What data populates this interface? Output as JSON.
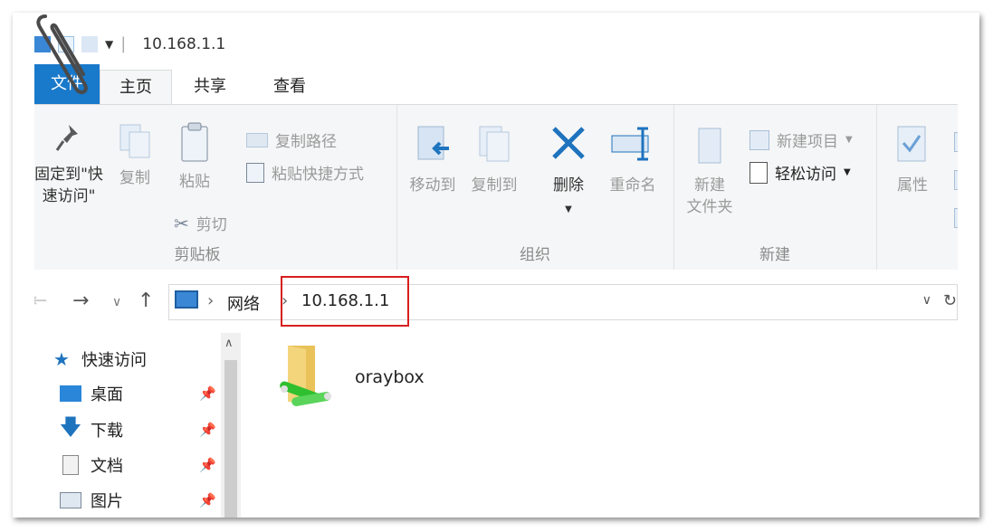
{
  "window": {
    "title": "10.168.1.1"
  },
  "tabs": {
    "file": "文件",
    "home": "主页",
    "share": "共享",
    "view": "查看"
  },
  "ribbon": {
    "clipboard": {
      "pin_line1": "固定到\"快",
      "pin_line2": "速访问\"",
      "copy": "复制",
      "paste": "粘贴",
      "copy_path": "复制路径",
      "paste_shortcut": "粘贴快捷方式",
      "cut": "剪切",
      "label": "剪贴板"
    },
    "organize": {
      "move_to": "移动到",
      "copy_to": "复制到",
      "delete": "删除",
      "rename": "重命名",
      "label": "组织"
    },
    "new": {
      "new_folder_line1": "新建",
      "new_folder_line2": "文件夹",
      "new_item": "新建项目",
      "easy_access": "轻松访问",
      "label": "新建"
    },
    "open": {
      "properties": "属性"
    }
  },
  "address": {
    "segments": [
      "网络",
      "10.168.1.1"
    ]
  },
  "nav": {
    "items": [
      {
        "label": "快速访问"
      },
      {
        "label": "桌面"
      },
      {
        "label": "下载"
      },
      {
        "label": "文档"
      },
      {
        "label": "图片"
      }
    ]
  },
  "content": {
    "items": [
      {
        "name": "oraybox"
      }
    ]
  },
  "colors": {
    "file_tab": "#1979ca",
    "highlight": "#d81e1e",
    "delete_x": "#1e73be"
  }
}
